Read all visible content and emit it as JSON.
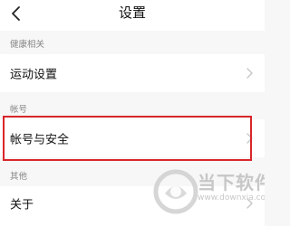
{
  "header": {
    "title": "设置"
  },
  "sections": {
    "health": {
      "label": "健康相关",
      "items": [
        {
          "label": "运动设置"
        }
      ]
    },
    "account": {
      "label": "帐号",
      "items": [
        {
          "label": "帐号与安全"
        }
      ]
    },
    "other": {
      "label": "其他",
      "items": [
        {
          "label": "关于"
        }
      ]
    }
  },
  "highlight_color": "#d9262b",
  "watermark": {
    "text": "当下软件园",
    "url": "www.downxia.com"
  }
}
